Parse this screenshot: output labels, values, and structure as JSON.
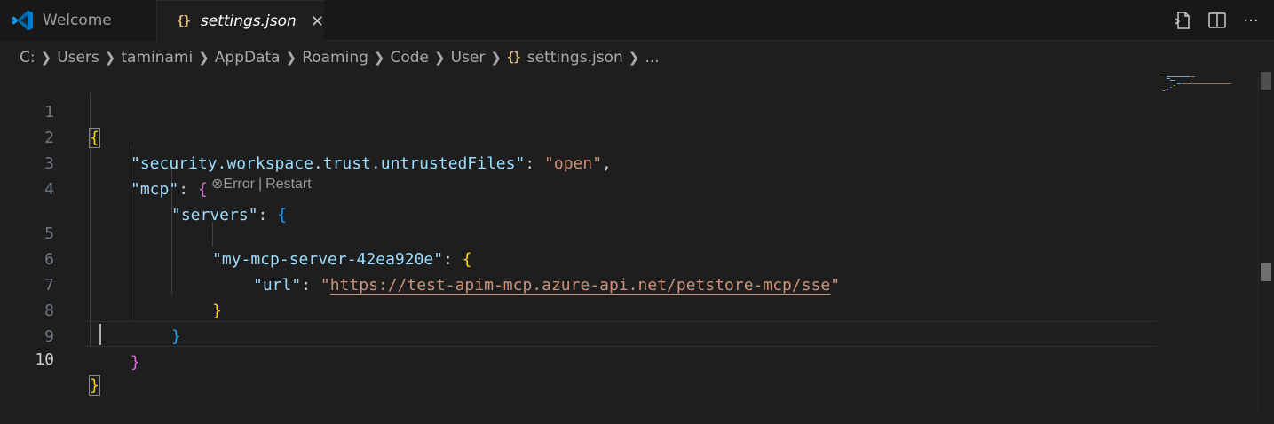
{
  "tabs": [
    {
      "label": "Welcome",
      "icon": "vscode-logo-icon",
      "active": false
    },
    {
      "label": "settings.json",
      "icon": "json-braces-icon",
      "active": true,
      "close": "✕"
    }
  ],
  "editor_actions": [
    {
      "name": "open-settings-icon"
    },
    {
      "name": "split-editor-icon"
    },
    {
      "name": "more-actions-icon",
      "glyph": "···"
    }
  ],
  "breadcrumb": [
    "C:",
    "Users",
    "taminami",
    "AppData",
    "Roaming",
    "Code",
    "User",
    "settings.json",
    "..."
  ],
  "codelens": {
    "error": "Error",
    "separator": "|",
    "restart": "Restart"
  },
  "code": {
    "l1_open": "{",
    "l2_key": "\"security.workspace.trust.untrustedFiles\"",
    "l2_colon": ": ",
    "l2_value": "\"open\"",
    "l2_comma": ",",
    "l3_key": "\"mcp\"",
    "l3_colon": ": ",
    "l3_brace": "{",
    "l4_key": "\"servers\"",
    "l4_colon": ": ",
    "l4_brace": "{",
    "l5_key": "\"my-mcp-server-42ea920e\"",
    "l5_colon": ": ",
    "l5_brace": "{",
    "l6_key": "\"url\"",
    "l6_colon": ": ",
    "l6_q1": "\"",
    "l6_url": "https://test-apim-mcp.azure-api.net/petstore-mcp/sse",
    "l6_q2": "\"",
    "l7_brace": "}",
    "l8_brace": "}",
    "l9_brace": "}",
    "l10_brace": "}"
  },
  "line_numbers": [
    "1",
    "2",
    "3",
    "4",
    "5",
    "6",
    "7",
    "8",
    "9",
    "10"
  ],
  "colors": {
    "editor_bg": "#1e1e1e",
    "json_key": "#9cdcfe",
    "json_string": "#ce9178",
    "bracket_level1": "#ffd700",
    "bracket_level2": "#da70d6",
    "bracket_level3": "#179fff"
  }
}
